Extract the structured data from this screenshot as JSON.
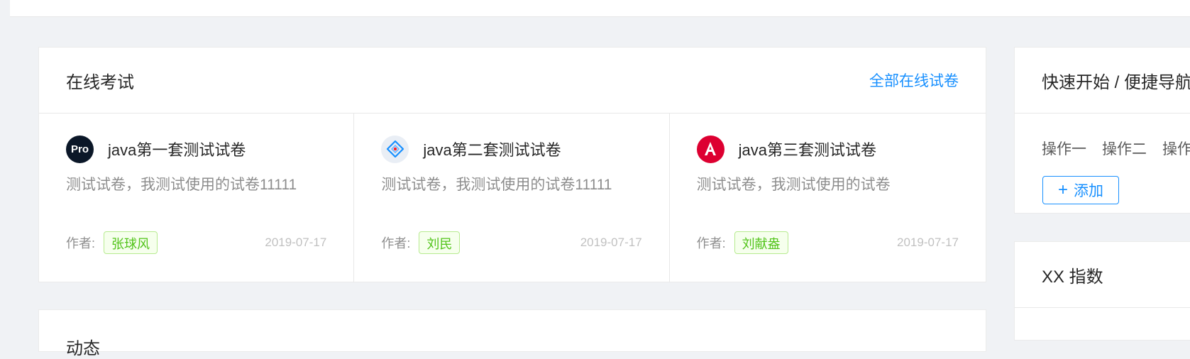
{
  "exams": {
    "title": "在线考试",
    "extra_link": "全部在线试卷",
    "items": [
      {
        "avatar": "pro-logo-icon",
        "avatar_text": "Pro",
        "title": "java第一套测试试卷",
        "desc": "测试试卷，我测试使用的试卷11111",
        "author_label": "作者:",
        "author": "张球风",
        "date": "2019-07-17"
      },
      {
        "avatar": "ant-design-logo-icon",
        "title": "java第二套测试试卷",
        "desc": "测试试卷，我测试使用的试卷11111",
        "author_label": "作者:",
        "author": "刘民",
        "date": "2019-07-17"
      },
      {
        "avatar": "angular-logo-icon",
        "title": "java第三套测试试卷",
        "desc": "测试试卷，我测试使用的试卷",
        "author_label": "作者:",
        "author": "刘献盎",
        "date": "2019-07-17"
      }
    ]
  },
  "dynamics": {
    "title": "动态"
  },
  "quick_start": {
    "title": "快速开始 / 便捷导航",
    "links": [
      "操作一",
      "操作二",
      "操作三"
    ],
    "add_button": "添加"
  },
  "xx_index": {
    "title": "XX 指数"
  },
  "colors": {
    "accent": "#1890ff",
    "tag_green": "#52c41a",
    "background": "#f0f2f5"
  }
}
